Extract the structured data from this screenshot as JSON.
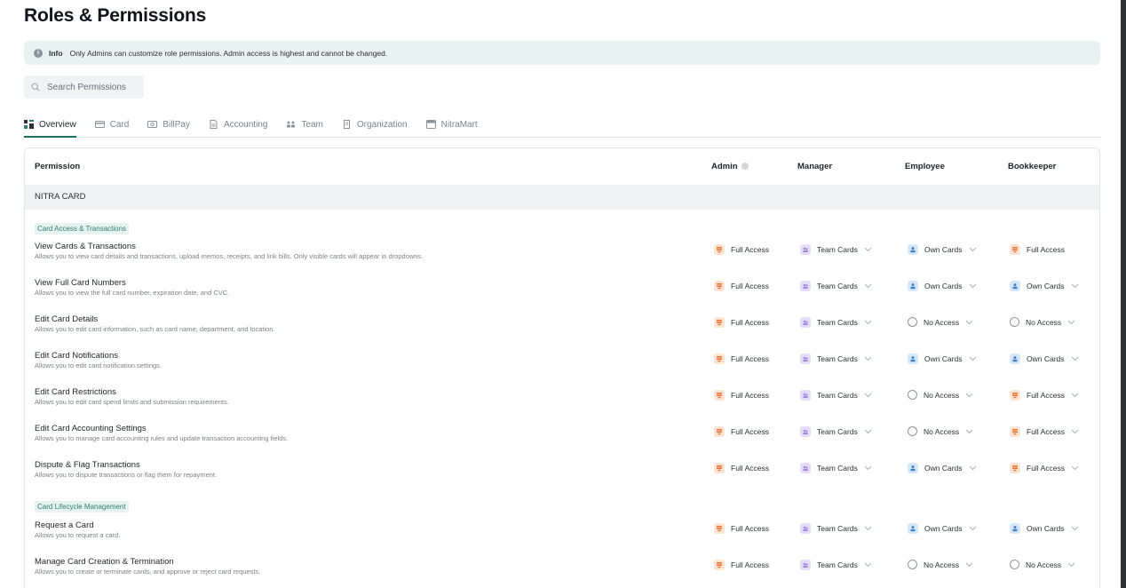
{
  "page": {
    "title": "Roles & Permissions"
  },
  "info": {
    "label": "Info",
    "text": "Only Admins can customize role permissions. Admin access is highest and cannot be changed."
  },
  "search": {
    "placeholder": "Search Permissions"
  },
  "tabs": [
    {
      "label": "Overview",
      "icon": "grid-icon",
      "active": true
    },
    {
      "label": "Card",
      "icon": "card-icon"
    },
    {
      "label": "BillPay",
      "icon": "bill-icon"
    },
    {
      "label": "Accounting",
      "icon": "document-icon"
    },
    {
      "label": "Team",
      "icon": "team-icon"
    },
    {
      "label": "Organization",
      "icon": "building-icon"
    },
    {
      "label": "NitraMart",
      "icon": "store-icon"
    }
  ],
  "table": {
    "headers": {
      "permission": "Permission",
      "admin": "Admin",
      "manager": "Manager",
      "employee": "Employee",
      "bookkeeper": "Bookkeeper"
    },
    "section": "NITRA CARD",
    "categories": [
      "Card Access & Transactions",
      "Card Lifecycle Management"
    ],
    "rows": [
      {
        "name": "View Cards & Transactions",
        "desc": "Allows you to view card details and transactions, upload memos, receipts, and link bills. Only visible cards will appear in dropdowns.",
        "admin": "Full Access",
        "manager": "Team Cards",
        "employee": "Own Cards",
        "bookkeeper": "Full Access",
        "bk_dropdown": false
      },
      {
        "name": "View Full Card Numbers",
        "desc": "Allows you to view the full card number, expiration date, and CVC.",
        "admin": "Full Access",
        "manager": "Team Cards",
        "employee": "Own Cards",
        "bookkeeper": "Own Cards",
        "bk_dropdown": true
      },
      {
        "name": "Edit Card Details",
        "desc": "Allows you to edit card information, such as card name, department, and location.",
        "admin": "Full Access",
        "manager": "Team Cards",
        "employee": "No Access",
        "bookkeeper": "No Access",
        "bk_dropdown": true
      },
      {
        "name": "Edit Card Notifications",
        "desc": "Allows you to edit card notification settings.",
        "admin": "Full Access",
        "manager": "Team Cards",
        "employee": "Own Cards",
        "bookkeeper": "Own Cards",
        "bk_dropdown": true
      },
      {
        "name": "Edit Card Restrictions",
        "desc": "Allows you to edit card spend limits and submission requirements.",
        "admin": "Full Access",
        "manager": "Team Cards",
        "employee": "No Access",
        "bookkeeper": "Full Access",
        "bk_dropdown": true
      },
      {
        "name": "Edit Card Accounting Settings",
        "desc": "Allows you to manage card accounting rules and update transaction accounting fields.",
        "admin": "Full Access",
        "manager": "Team Cards",
        "employee": "No Access",
        "bookkeeper": "Full Access",
        "bk_dropdown": true
      },
      {
        "name": "Dispute & Flag Transactions",
        "desc": "Allows you to dispute transactions or flag them for repayment.",
        "admin": "Full Access",
        "manager": "Team Cards",
        "employee": "Own Cards",
        "bookkeeper": "Full Access",
        "bk_dropdown": true
      },
      {
        "name": "Request a Card",
        "desc": "Allows you to request a card.",
        "admin": "Full Access",
        "manager": "Team Cards",
        "employee": "Own Cards",
        "bookkeeper": "Own Cards",
        "bk_dropdown": true
      },
      {
        "name": "Manage Card Creation & Termination",
        "desc": "Allows you to create or terminate cards, and approve or reject card requests.",
        "admin": "Full Access",
        "manager": "Team Cards",
        "employee": "No Access",
        "bookkeeper": "No Access",
        "bk_dropdown": true
      }
    ]
  },
  "colors": {
    "accent": "#1f6e62",
    "info_bg": "#e8f3f1",
    "full": "#e8743b",
    "team": "#9b86d8",
    "own": "#3f7fc4",
    "none": "#8d959c"
  }
}
